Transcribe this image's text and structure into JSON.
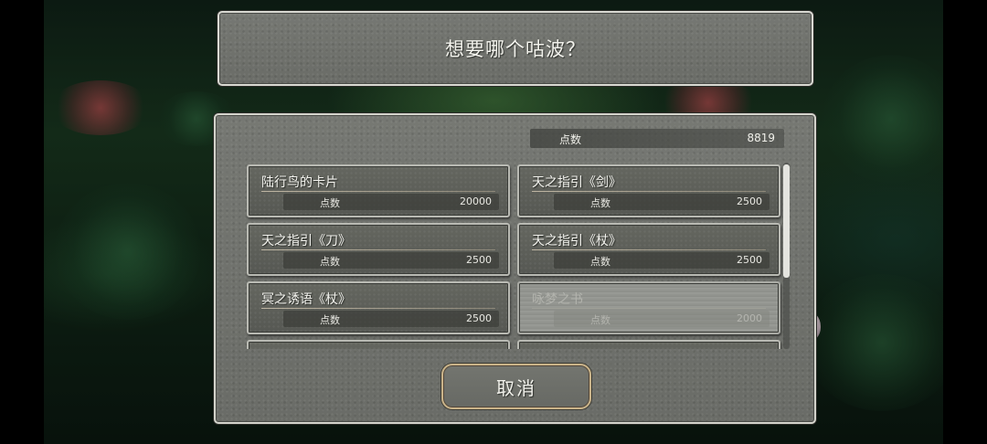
{
  "title": "想要哪个咕波？",
  "points": {
    "label": "点数",
    "value": "8819"
  },
  "items": [
    {
      "name": "陆行鸟的卡片",
      "cost_label": "点数",
      "cost": "20000",
      "enabled": true
    },
    {
      "name": "天之指引《剑》",
      "cost_label": "点数",
      "cost": "2500",
      "enabled": true
    },
    {
      "name": "天之指引《刀》",
      "cost_label": "点数",
      "cost": "2500",
      "enabled": true
    },
    {
      "name": "天之指引《杖》",
      "cost_label": "点数",
      "cost": "2500",
      "enabled": true
    },
    {
      "name": "冥之诱语《杖》",
      "cost_label": "点数",
      "cost": "2500",
      "enabled": true
    },
    {
      "name": "咏梦之书",
      "cost_label": "点数",
      "cost": "2000",
      "enabled": false
    }
  ],
  "cancel_label": "取消",
  "colors": {
    "panel_stone": "#6e706b",
    "panel_border": "#d4d4cc",
    "cancel_border": "#c9b389",
    "text": "#f2f2ec",
    "disabled_text": "#b3b4ae"
  }
}
